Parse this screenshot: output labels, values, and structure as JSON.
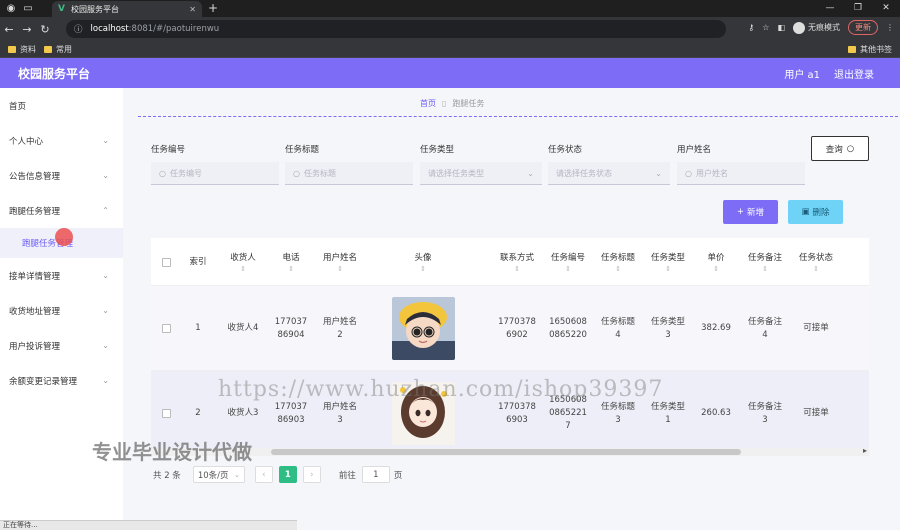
{
  "browser": {
    "tab_title": "校园服务平台",
    "url_host": "localhost",
    "url_port_path": ":8081/#/paotuirenwu",
    "incognito_label": "无痕模式",
    "update_label": "更新",
    "bookmarks": [
      "资料",
      "常用"
    ],
    "bookmarks_right": "其他书签",
    "status_text": "正在等待..."
  },
  "header": {
    "title": "校园服务平台",
    "user_label": "用户 a1",
    "logout_label": "退出登录",
    "bg_color": "#7c6cf6"
  },
  "sidebar": {
    "items": [
      {
        "label": "首页"
      },
      {
        "label": "个人中心"
      },
      {
        "label": "公告信息管理"
      },
      {
        "label": "跑腿任务管理"
      },
      {
        "label": "接单详情管理"
      },
      {
        "label": "收货地址管理"
      },
      {
        "label": "用户投诉管理"
      },
      {
        "label": "余额变更记录管理"
      }
    ],
    "sub_item": "跑腿任务管理"
  },
  "breadcrumb": {
    "home": "首页",
    "current": "跑腿任务"
  },
  "filters": [
    {
      "label": "任务编号",
      "placeholder": "任务编号"
    },
    {
      "label": "任务标题",
      "placeholder": "任务标题"
    },
    {
      "label": "任务类型",
      "placeholder": "请选择任务类型"
    },
    {
      "label": "任务状态",
      "placeholder": "请选择任务状态"
    },
    {
      "label": "用户姓名",
      "placeholder": "用户姓名"
    }
  ],
  "actions": {
    "query": "查询",
    "add": "新增",
    "delete": "删除"
  },
  "table": {
    "columns": [
      "索引",
      "收货人",
      "电话",
      "用户姓名",
      "头像",
      "联系方式",
      "任务编号",
      "任务标题",
      "任务类型",
      "单价",
      "任务备注",
      "任务状态"
    ],
    "rows": [
      {
        "index": "1",
        "receiver": "收货人4",
        "phone": "17703786904",
        "username": "用户姓名2",
        "contact": "17703786902",
        "task_no": "16506080865220",
        "title": "任务标题4",
        "type": "任务类型3",
        "price": "382.69",
        "remark": "任务备注4",
        "status": "可接单"
      },
      {
        "index": "2",
        "receiver": "收货人3",
        "phone": "17703786903",
        "username": "用户姓名3",
        "contact": "17703786903",
        "task_no": "16506080865221 7",
        "title": "任务标题3",
        "type": "任务类型1",
        "price": "260.63",
        "remark": "任务备注3",
        "status": "可接单"
      }
    ]
  },
  "pagination": {
    "total": "共 2 条",
    "page_size": "10条/页",
    "current_page": "1",
    "goto_label": "前往",
    "goto_value": "1",
    "page_suffix": "页"
  },
  "watermark": {
    "url": "https://www.huzhan.com/ishop39397",
    "slogan": "专业毕业设计代做"
  }
}
